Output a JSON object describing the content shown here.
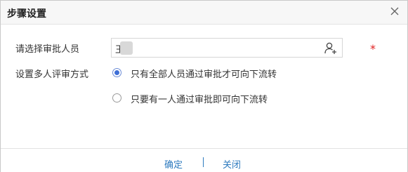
{
  "dialog": {
    "title": "步骤设置"
  },
  "form": {
    "approver_label": "请选择审批人员",
    "approver_value": "王",
    "mode_label": "设置多人评审方式",
    "options": [
      {
        "label": "只有全部人员通过审批才可向下流转",
        "checked": true
      },
      {
        "label": "只要有一人通过审批即可向下流转",
        "checked": false
      }
    ],
    "required_mark": "*"
  },
  "footer": {
    "confirm_label": "确定",
    "close_label": "关闭"
  },
  "colors": {
    "link": "#2e7bbf",
    "required": "#e02020",
    "radio_checked": "#3f6fd6"
  }
}
